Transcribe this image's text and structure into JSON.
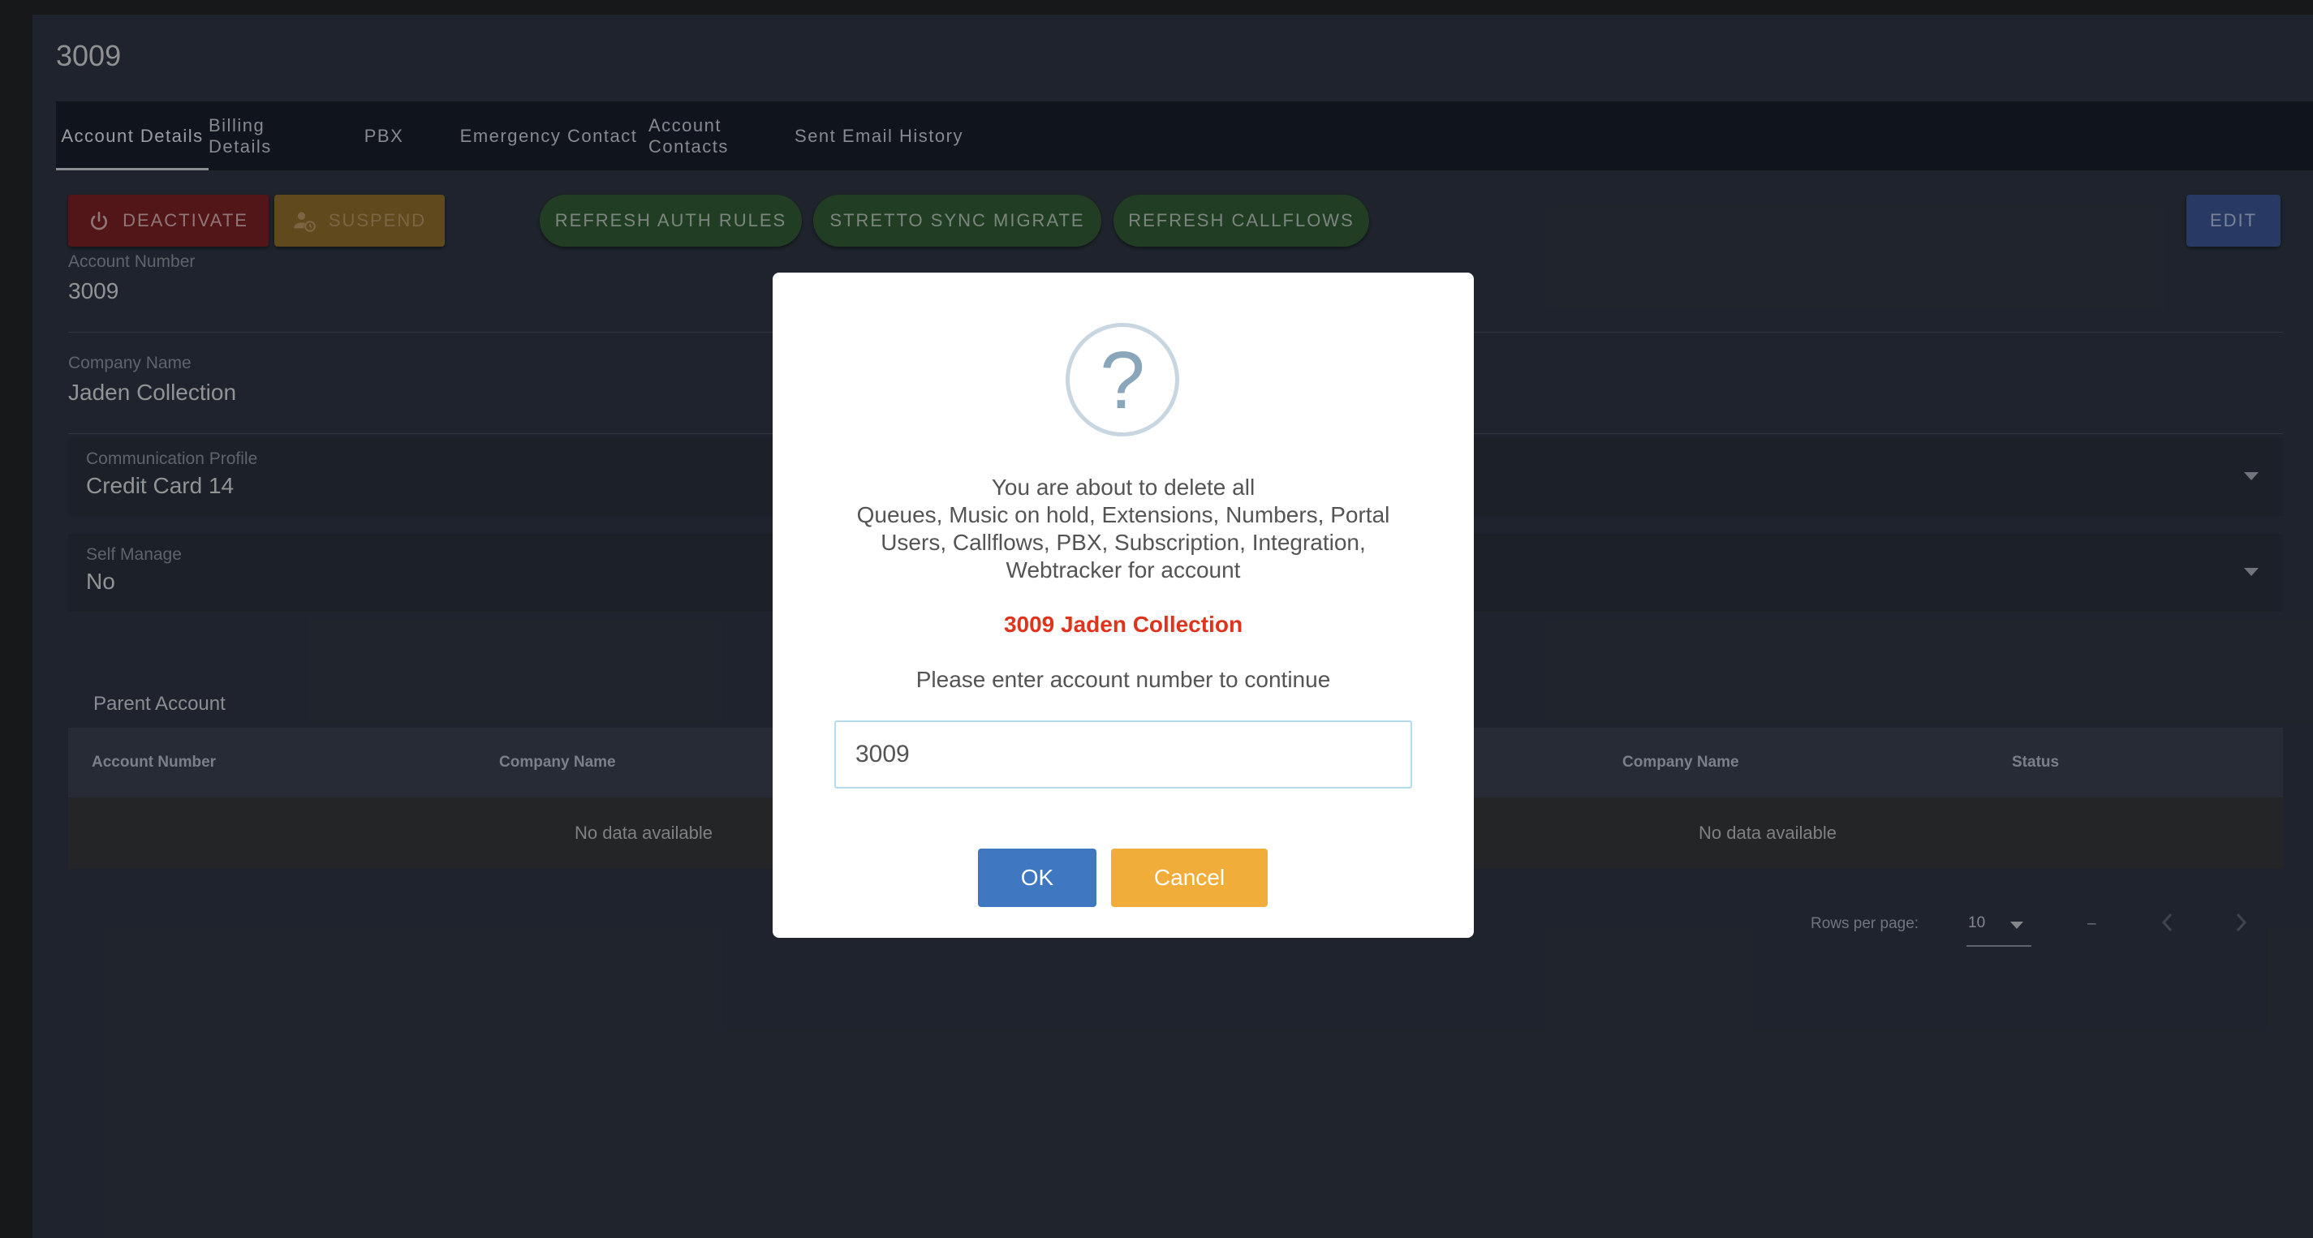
{
  "page": {
    "title": "3009"
  },
  "tabs": [
    {
      "label": "Account Details",
      "active": true
    },
    {
      "label": "Billing Details"
    },
    {
      "label": "PBX"
    },
    {
      "label": "Emergency Contact"
    },
    {
      "label": "Account Contacts"
    },
    {
      "label": "Sent Email History"
    }
  ],
  "actions": {
    "deactivate": "DEACTIVATE",
    "suspend": "SUSPEND",
    "refresh_auth_rules": "REFRESH AUTH RULES",
    "stretto_sync_migrate": "STRETTO SYNC MIGRATE",
    "refresh_callflows": "REFRESH CALLFLOWS",
    "edit": "EDIT"
  },
  "fields": {
    "account_number": {
      "label": "Account Number",
      "value": "3009"
    },
    "company_name": {
      "label": "Company Name",
      "value": "Jaden Collection"
    },
    "communication_profile": {
      "label": "Communication Profile",
      "value": "Credit Card 14"
    },
    "self_manage": {
      "label": "Self Manage",
      "value": "No"
    }
  },
  "parent_account": {
    "title": "Parent Account",
    "columns": [
      "Account Number",
      "Company Name"
    ],
    "empty_text": "No data available"
  },
  "child_table": {
    "columns": [
      "Company Name",
      "Status"
    ],
    "empty_text": "No data available"
  },
  "pager": {
    "rows_per_page_label": "Rows per page:",
    "rows_per_page_value": "10",
    "range_text": "–"
  },
  "modal": {
    "message_lines": [
      "You are about to delete all",
      "Queues, Music on hold, Extensions, Numbers, Portal",
      "Users, Callflows, PBX, Subscription, Integration,",
      "Webtracker for account"
    ],
    "account_text": "3009 Jaden Collection",
    "prompt": "Please enter account number to continue",
    "input_value": "3009",
    "ok_label": "OK",
    "cancel_label": "Cancel"
  },
  "colors": {
    "accent_red": "#e0331c",
    "ok_blue": "#3f78c0",
    "cancel_orange": "#f0ad3a"
  }
}
